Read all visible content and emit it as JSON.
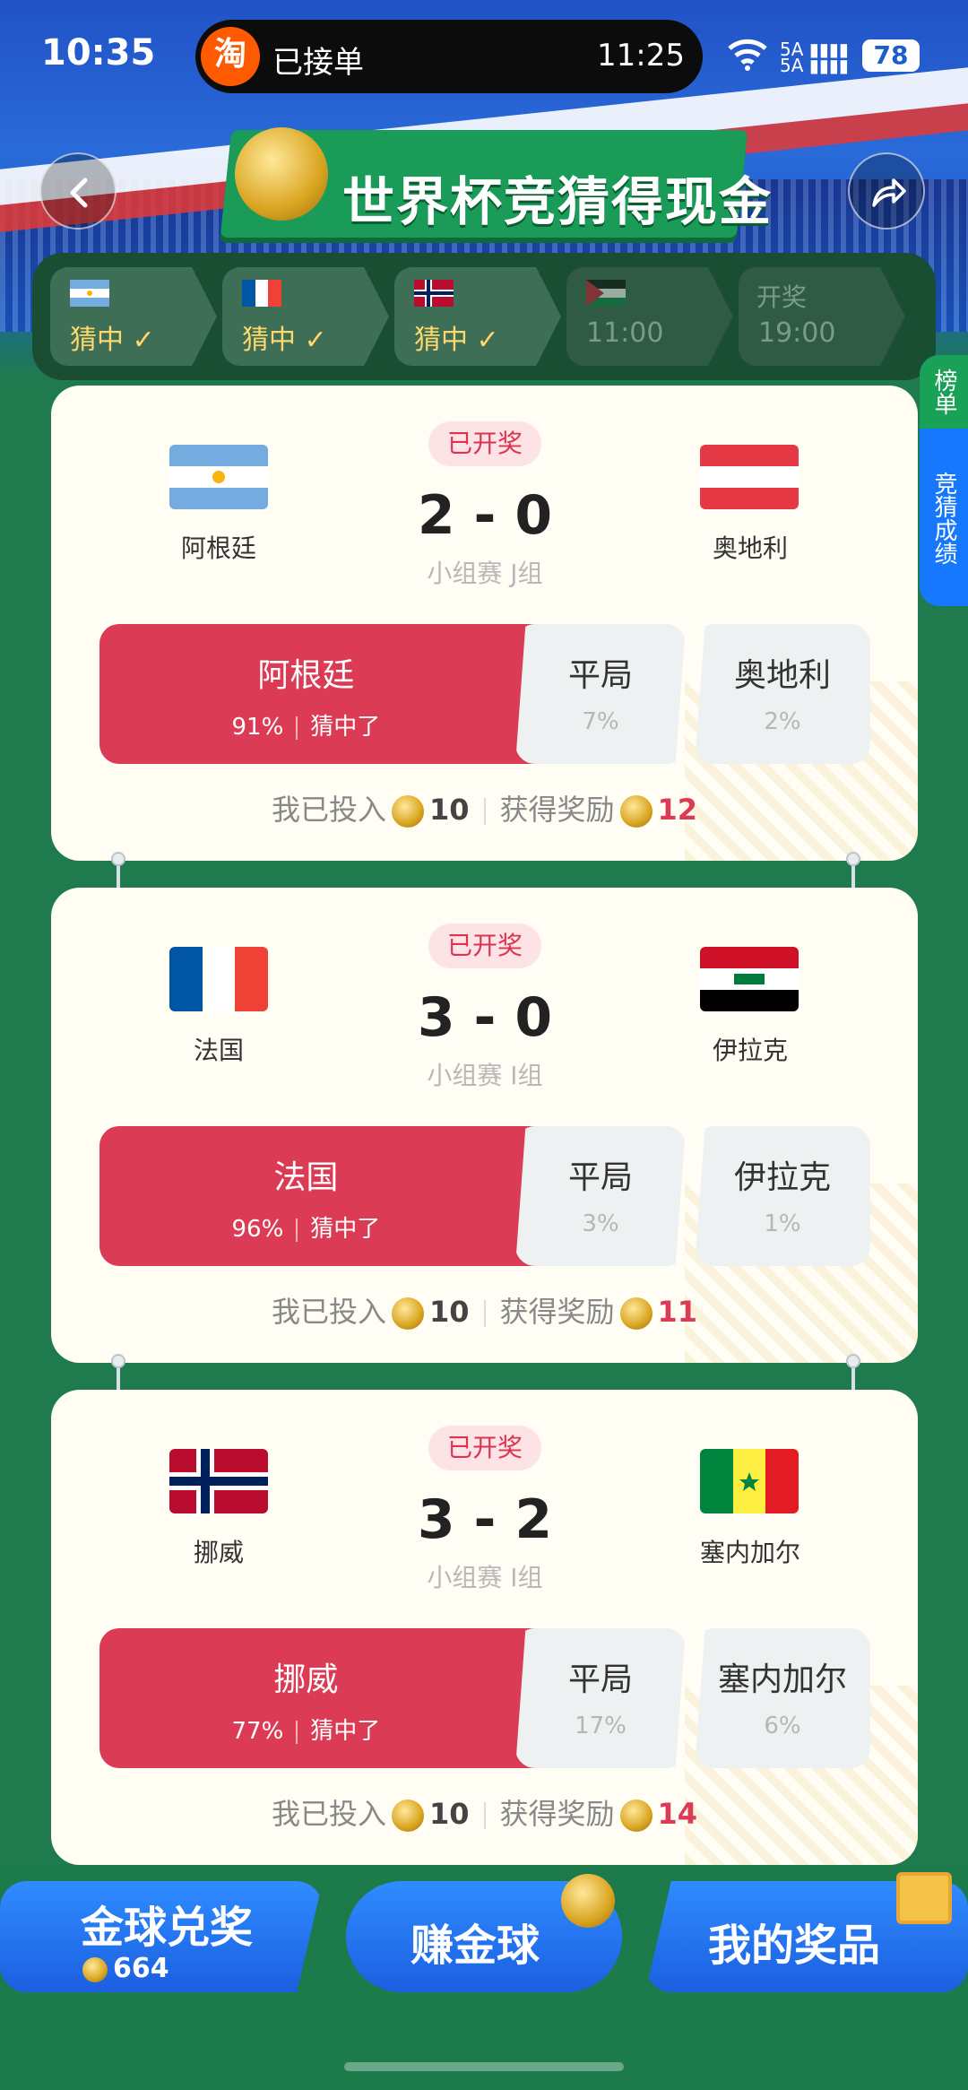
{
  "status_bar": {
    "time": "10:35",
    "battery": "78",
    "signal_text": "5A\n5A"
  },
  "live_activity": {
    "app_icon": "淘",
    "title": "已接单",
    "time": "11:25"
  },
  "header": {
    "title": "世界杯竞猜得现金",
    "back_icon": "chevron-left-icon",
    "share_icon": "share-icon"
  },
  "progress_steps": [
    {
      "flag": "argentina",
      "label": "猜中 ✓",
      "state": "done"
    },
    {
      "flag": "france",
      "label": "猜中 ✓",
      "state": "done"
    },
    {
      "flag": "norway",
      "label": "猜中 ✓",
      "state": "done"
    },
    {
      "flag": "jordan",
      "label": "11:00",
      "state": "pending"
    },
    {
      "flag": "",
      "top": "开奖",
      "label": "19:00",
      "state": "pending"
    }
  ],
  "side_tabs": {
    "leaderboard": "榜单",
    "results": "竞猜成绩"
  },
  "matches": [
    {
      "badge": "已开奖",
      "home": {
        "name": "阿根廷",
        "flag": "argentina"
      },
      "away": {
        "name": "奥地利",
        "flag": "austria"
      },
      "score": "2 - 0",
      "group": "小组赛 J组",
      "options": {
        "win": {
          "label": "阿根廷",
          "pct": "91%",
          "result": "猜中了"
        },
        "draw": {
          "label": "平局",
          "pct": "7%"
        },
        "lose": {
          "label": "奥地利",
          "pct": "2%"
        }
      },
      "stake_label": "我已投入",
      "stake": "10",
      "reward_label": "获得奖励",
      "reward": "12"
    },
    {
      "badge": "已开奖",
      "home": {
        "name": "法国",
        "flag": "france"
      },
      "away": {
        "name": "伊拉克",
        "flag": "iraq"
      },
      "score": "3 - 0",
      "group": "小组赛 I组",
      "options": {
        "win": {
          "label": "法国",
          "pct": "96%",
          "result": "猜中了"
        },
        "draw": {
          "label": "平局",
          "pct": "3%"
        },
        "lose": {
          "label": "伊拉克",
          "pct": "1%"
        }
      },
      "stake_label": "我已投入",
      "stake": "10",
      "reward_label": "获得奖励",
      "reward": "11"
    },
    {
      "badge": "已开奖",
      "home": {
        "name": "挪威",
        "flag": "norway"
      },
      "away": {
        "name": "塞内加尔",
        "flag": "senegal"
      },
      "score": "3 - 2",
      "group": "小组赛 I组",
      "options": {
        "win": {
          "label": "挪威",
          "pct": "77%",
          "result": "猜中了"
        },
        "draw": {
          "label": "平局",
          "pct": "17%"
        },
        "lose": {
          "label": "塞内加尔",
          "pct": "6%"
        }
      },
      "stake_label": "我已投入",
      "stake": "10",
      "reward_label": "获得奖励",
      "reward": "14"
    }
  ],
  "bottom_bar": {
    "redeem": "金球兑奖",
    "coin_count": "664",
    "earn": "赚金球",
    "prizes": "我的奖品"
  },
  "colors": {
    "accent_red": "#dc3b55",
    "field_green": "#1f7a4d",
    "button_blue": "#1b5fe0"
  }
}
